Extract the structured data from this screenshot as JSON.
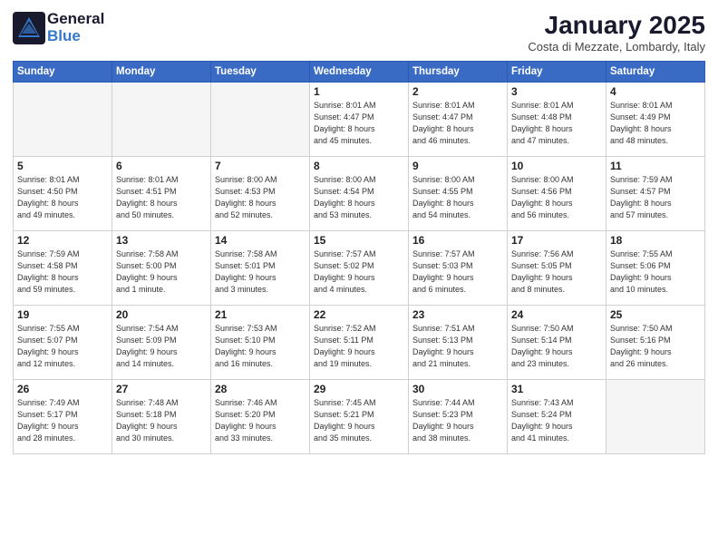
{
  "header": {
    "logo_general": "General",
    "logo_blue": "Blue",
    "month": "January 2025",
    "location": "Costa di Mezzate, Lombardy, Italy"
  },
  "weekdays": [
    "Sunday",
    "Monday",
    "Tuesday",
    "Wednesday",
    "Thursday",
    "Friday",
    "Saturday"
  ],
  "weeks": [
    [
      {
        "day": "",
        "info": ""
      },
      {
        "day": "",
        "info": ""
      },
      {
        "day": "",
        "info": ""
      },
      {
        "day": "1",
        "info": "Sunrise: 8:01 AM\nSunset: 4:47 PM\nDaylight: 8 hours\nand 45 minutes."
      },
      {
        "day": "2",
        "info": "Sunrise: 8:01 AM\nSunset: 4:47 PM\nDaylight: 8 hours\nand 46 minutes."
      },
      {
        "day": "3",
        "info": "Sunrise: 8:01 AM\nSunset: 4:48 PM\nDaylight: 8 hours\nand 47 minutes."
      },
      {
        "day": "4",
        "info": "Sunrise: 8:01 AM\nSunset: 4:49 PM\nDaylight: 8 hours\nand 48 minutes."
      }
    ],
    [
      {
        "day": "5",
        "info": "Sunrise: 8:01 AM\nSunset: 4:50 PM\nDaylight: 8 hours\nand 49 minutes."
      },
      {
        "day": "6",
        "info": "Sunrise: 8:01 AM\nSunset: 4:51 PM\nDaylight: 8 hours\nand 50 minutes."
      },
      {
        "day": "7",
        "info": "Sunrise: 8:00 AM\nSunset: 4:53 PM\nDaylight: 8 hours\nand 52 minutes."
      },
      {
        "day": "8",
        "info": "Sunrise: 8:00 AM\nSunset: 4:54 PM\nDaylight: 8 hours\nand 53 minutes."
      },
      {
        "day": "9",
        "info": "Sunrise: 8:00 AM\nSunset: 4:55 PM\nDaylight: 8 hours\nand 54 minutes."
      },
      {
        "day": "10",
        "info": "Sunrise: 8:00 AM\nSunset: 4:56 PM\nDaylight: 8 hours\nand 56 minutes."
      },
      {
        "day": "11",
        "info": "Sunrise: 7:59 AM\nSunset: 4:57 PM\nDaylight: 8 hours\nand 57 minutes."
      }
    ],
    [
      {
        "day": "12",
        "info": "Sunrise: 7:59 AM\nSunset: 4:58 PM\nDaylight: 8 hours\nand 59 minutes."
      },
      {
        "day": "13",
        "info": "Sunrise: 7:58 AM\nSunset: 5:00 PM\nDaylight: 9 hours\nand 1 minute."
      },
      {
        "day": "14",
        "info": "Sunrise: 7:58 AM\nSunset: 5:01 PM\nDaylight: 9 hours\nand 3 minutes."
      },
      {
        "day": "15",
        "info": "Sunrise: 7:57 AM\nSunset: 5:02 PM\nDaylight: 9 hours\nand 4 minutes."
      },
      {
        "day": "16",
        "info": "Sunrise: 7:57 AM\nSunset: 5:03 PM\nDaylight: 9 hours\nand 6 minutes."
      },
      {
        "day": "17",
        "info": "Sunrise: 7:56 AM\nSunset: 5:05 PM\nDaylight: 9 hours\nand 8 minutes."
      },
      {
        "day": "18",
        "info": "Sunrise: 7:55 AM\nSunset: 5:06 PM\nDaylight: 9 hours\nand 10 minutes."
      }
    ],
    [
      {
        "day": "19",
        "info": "Sunrise: 7:55 AM\nSunset: 5:07 PM\nDaylight: 9 hours\nand 12 minutes."
      },
      {
        "day": "20",
        "info": "Sunrise: 7:54 AM\nSunset: 5:09 PM\nDaylight: 9 hours\nand 14 minutes."
      },
      {
        "day": "21",
        "info": "Sunrise: 7:53 AM\nSunset: 5:10 PM\nDaylight: 9 hours\nand 16 minutes."
      },
      {
        "day": "22",
        "info": "Sunrise: 7:52 AM\nSunset: 5:11 PM\nDaylight: 9 hours\nand 19 minutes."
      },
      {
        "day": "23",
        "info": "Sunrise: 7:51 AM\nSunset: 5:13 PM\nDaylight: 9 hours\nand 21 minutes."
      },
      {
        "day": "24",
        "info": "Sunrise: 7:50 AM\nSunset: 5:14 PM\nDaylight: 9 hours\nand 23 minutes."
      },
      {
        "day": "25",
        "info": "Sunrise: 7:50 AM\nSunset: 5:16 PM\nDaylight: 9 hours\nand 26 minutes."
      }
    ],
    [
      {
        "day": "26",
        "info": "Sunrise: 7:49 AM\nSunset: 5:17 PM\nDaylight: 9 hours\nand 28 minutes."
      },
      {
        "day": "27",
        "info": "Sunrise: 7:48 AM\nSunset: 5:18 PM\nDaylight: 9 hours\nand 30 minutes."
      },
      {
        "day": "28",
        "info": "Sunrise: 7:46 AM\nSunset: 5:20 PM\nDaylight: 9 hours\nand 33 minutes."
      },
      {
        "day": "29",
        "info": "Sunrise: 7:45 AM\nSunset: 5:21 PM\nDaylight: 9 hours\nand 35 minutes."
      },
      {
        "day": "30",
        "info": "Sunrise: 7:44 AM\nSunset: 5:23 PM\nDaylight: 9 hours\nand 38 minutes."
      },
      {
        "day": "31",
        "info": "Sunrise: 7:43 AM\nSunset: 5:24 PM\nDaylight: 9 hours\nand 41 minutes."
      },
      {
        "day": "",
        "info": ""
      }
    ]
  ]
}
